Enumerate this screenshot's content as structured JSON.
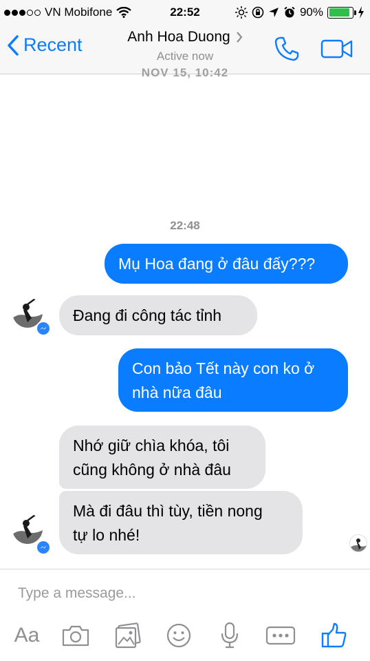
{
  "status_bar": {
    "carrier": "VN Mobifone",
    "time": "22:52",
    "battery": "90%",
    "battery_level": 0.9
  },
  "nav": {
    "back_label": "Recent",
    "contact_name": "Anh Hoa Duong",
    "contact_status": "Active now"
  },
  "thread": {
    "date_stamp": "NOV 15, 10:42",
    "time_stamp": "22:48",
    "messages": [
      {
        "direction": "out",
        "lines": [
          "Mụ Hoa đang ở đâu đấy???"
        ]
      },
      {
        "direction": "in",
        "lines": [
          "Đang đi công tác tỉnh"
        ]
      },
      {
        "direction": "out",
        "lines": [
          "Con bảo Tết này con ko ở",
          "nhà nữa đâu"
        ]
      },
      {
        "direction": "in",
        "lines": [
          "Nhớ giữ chìa khóa, tôi",
          "cũng không ở nhà đâu"
        ]
      },
      {
        "direction": "in",
        "lines": [
          "Mà đi đâu thì tùy, tiền nong",
          "tự lo nhé!"
        ]
      }
    ]
  },
  "composer": {
    "placeholder": "Type a message...",
    "aa_label": "Aa"
  },
  "colors": {
    "accent": "#0a7cff",
    "incoming_bubble": "#e4e4e6",
    "battery": "#2ec04a"
  },
  "icons": [
    "signal-icon",
    "wifi-icon",
    "brightness-icon",
    "lock-rotation-icon",
    "location-icon",
    "alarm-icon",
    "battery-icon",
    "charging-icon",
    "back-chevron-icon",
    "chevron-right-icon",
    "phone-icon",
    "video-camera-icon",
    "camera-icon",
    "gallery-icon",
    "emoji-icon",
    "microphone-icon",
    "more-icon",
    "thumbs-up-icon"
  ]
}
